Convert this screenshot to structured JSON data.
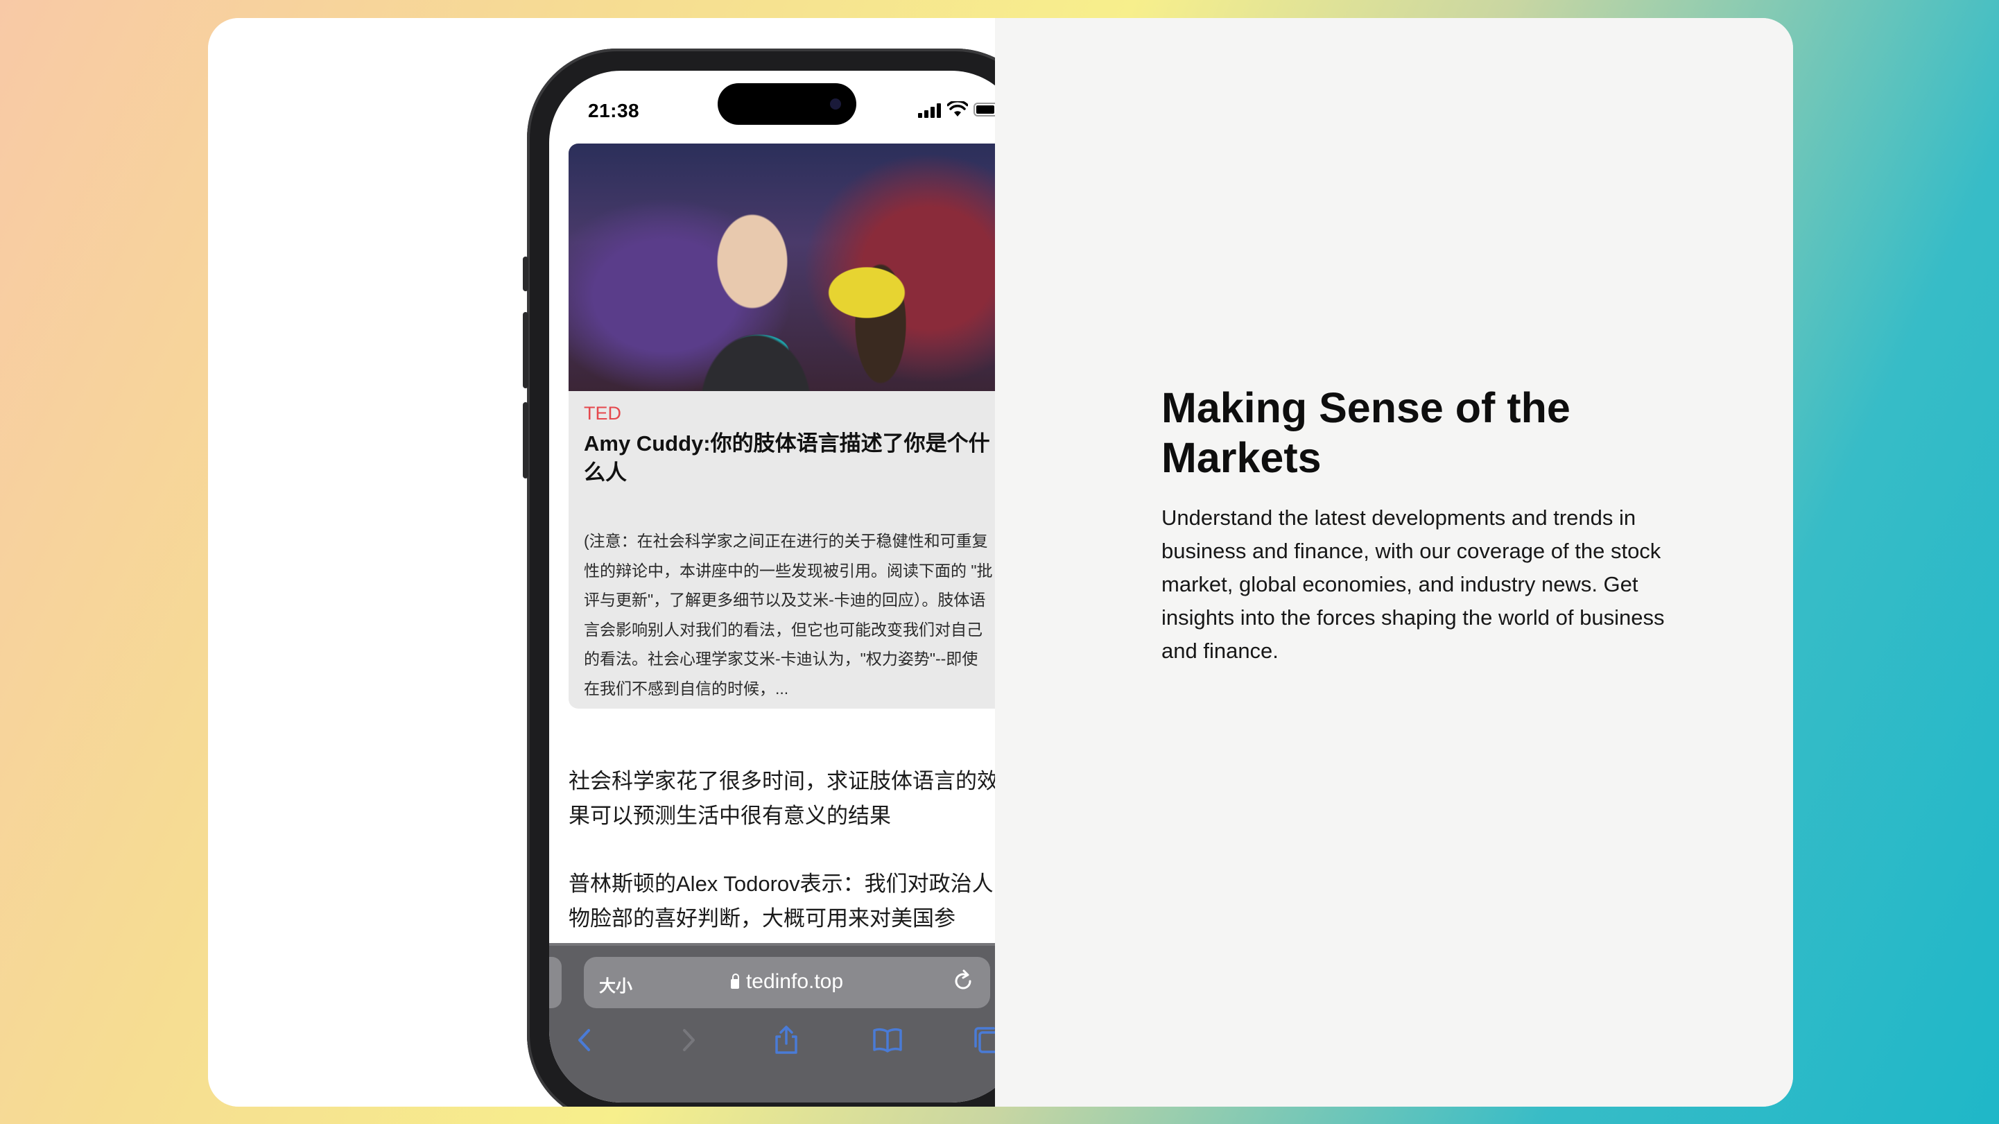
{
  "phone": {
    "status_bar": {
      "time": "21:38"
    },
    "article_card": {
      "source": "TED",
      "title": "Amy Cuddy:你的肢体语言描述了你是个什么人",
      "summary": "(注意：在社会科学家之间正在进行的关于稳健性和可重复性的辩论中，本讲座中的一些发现被引用。阅读下面的 \"批评与更新\"，了解更多细节以及艾米-卡迪的回应）。肢体语言会影响别人对我们的看法，但它也可能改变我们对自己的看法。社会心理学家艾米-卡迪认为，\"权力姿势\"--即使在我们不感到自信的时候，..."
    },
    "paragraphs": [
      "社会科学家花了很多时间，求证肢体语言的效果可以预测生活中很有意义的结果",
      "普林斯顿的Alex Todorov表示：我们对政治人物脸部的喜好判断，大概可用来对美国参"
    ],
    "browser": {
      "text_size_label": "大小",
      "url": "tedinfo.top"
    }
  },
  "hero": {
    "title": "Making Sense of the Markets",
    "description": "Understand the latest developments and trends in business and finance, with our coverage of the stock market, global economies, and industry news. Get insights into the forces shaping the world of business and finance."
  },
  "colors": {
    "accent_blue": "#4a7bd6",
    "source_red": "#e5484d",
    "toolbar_gray": "#5f5f63"
  },
  "icons": [
    "signal-icon",
    "wifi-icon",
    "battery-icon",
    "lock-icon",
    "reload-icon",
    "back-icon",
    "forward-icon",
    "share-icon",
    "bookmarks-icon",
    "tabs-icon"
  ]
}
